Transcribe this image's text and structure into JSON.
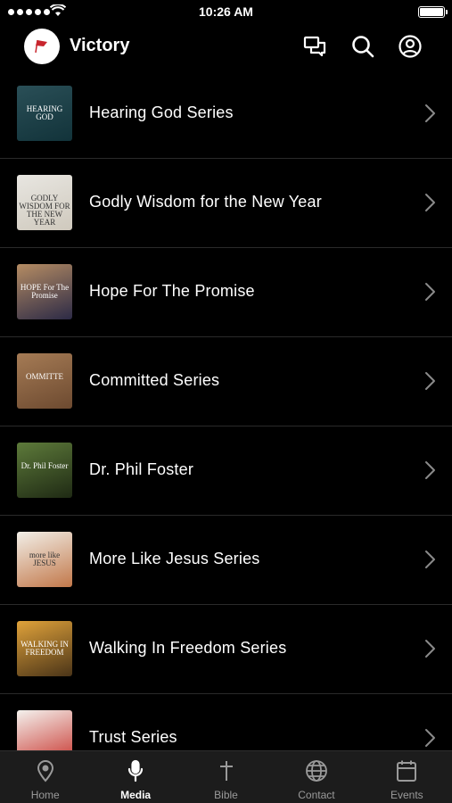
{
  "status_bar": {
    "time": "10:26 AM"
  },
  "header": {
    "title": "Victory",
    "logo_text": "VICTORY"
  },
  "media_items": [
    {
      "label": "Hearing God Series",
      "thumb_text": "HEARING GOD",
      "thumb_colors": [
        "#2a4f57",
        "#12333a"
      ]
    },
    {
      "label": "Godly Wisdom for the New Year",
      "thumb_text": "GODLY WISDOM FOR THE NEW YEAR",
      "thumb_colors": [
        "#e8e6e1",
        "#cfc9bd"
      ]
    },
    {
      "label": "Hope For The Promise",
      "thumb_text": "HOPE For The Promise",
      "thumb_colors": [
        "#b58c63",
        "#2c2a46"
      ]
    },
    {
      "label": "Committed Series",
      "thumb_text": "OMMITTE",
      "thumb_colors": [
        "#a57b55",
        "#6d4a30"
      ]
    },
    {
      "label": "Dr. Phil Foster",
      "thumb_text": "Dr. Phil Foster",
      "thumb_colors": [
        "#5d7a3a",
        "#1f2a14"
      ]
    },
    {
      "label": "More Like Jesus Series",
      "thumb_text": "more like JESUS",
      "thumb_colors": [
        "#f2efe8",
        "#c2784a"
      ]
    },
    {
      "label": "Walking In Freedom Series",
      "thumb_text": "WALKING IN FREEDOM",
      "thumb_colors": [
        "#e0a23a",
        "#4a3418"
      ]
    },
    {
      "label": "Trust Series",
      "thumb_text": "",
      "thumb_colors": [
        "#f4f2ee",
        "#c7322b"
      ]
    }
  ],
  "tabs": [
    {
      "label": "Home",
      "icon": "map-pin-icon",
      "active": false
    },
    {
      "label": "Media",
      "icon": "microphone-icon",
      "active": true
    },
    {
      "label": "Bible",
      "icon": "cross-icon",
      "active": false
    },
    {
      "label": "Contact",
      "icon": "globe-icon",
      "active": false
    },
    {
      "label": "Events",
      "icon": "calendar-icon",
      "active": false
    }
  ],
  "colors": {
    "background": "#000000",
    "tab_bar": "#1c1c1c",
    "tab_inactive": "#9a9a9a",
    "divider": "#2a2a2a"
  }
}
